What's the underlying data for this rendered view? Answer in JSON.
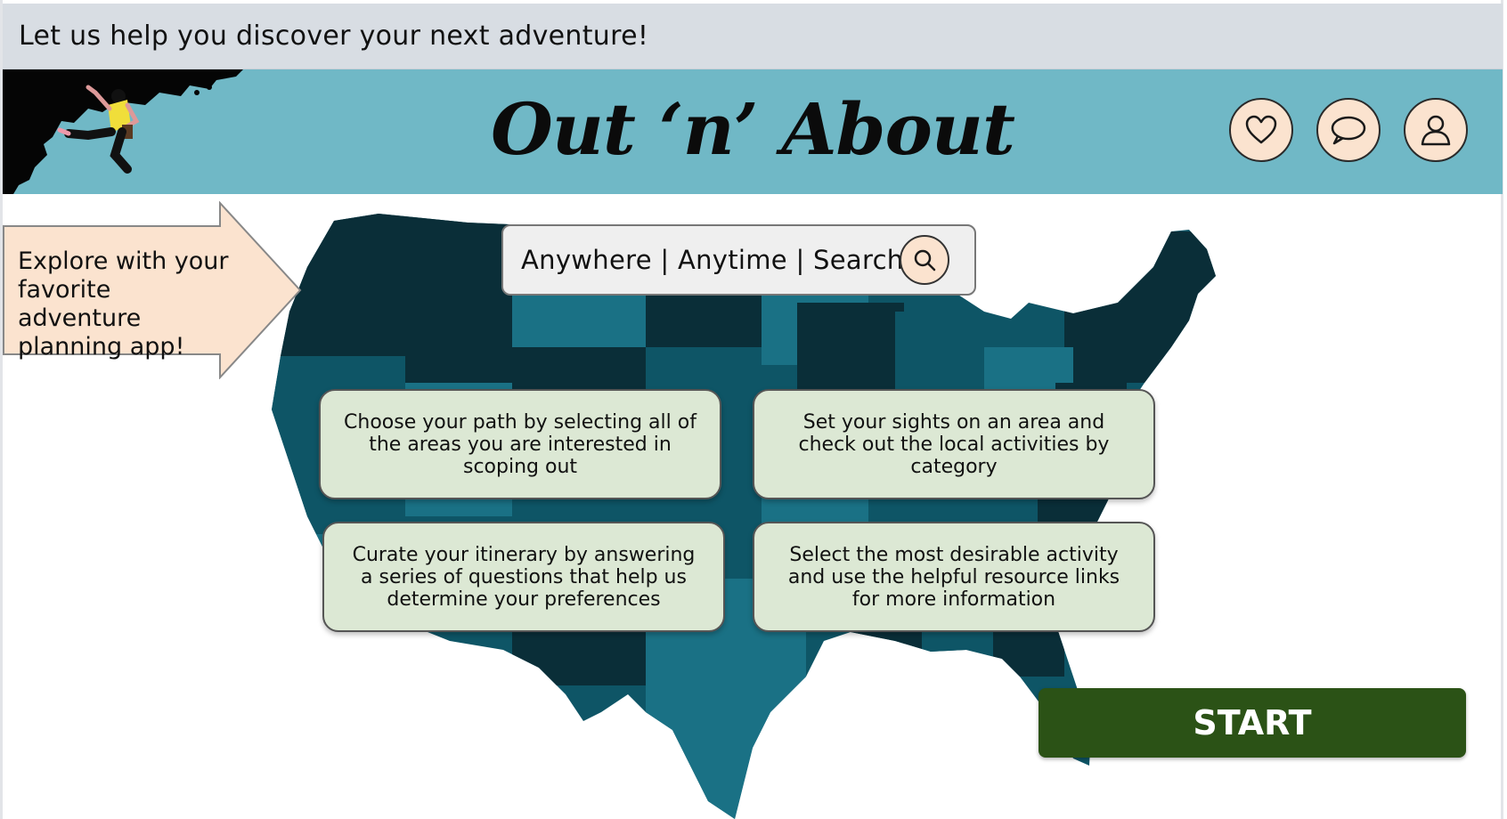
{
  "banner": {
    "text": "Let us help you discover your next adventure!"
  },
  "header": {
    "logo": "Out ‘n’ About",
    "icons": [
      "heart-icon",
      "chat-bubble-icon",
      "user-icon"
    ]
  },
  "callout": {
    "text": "Explore with your favorite adventure planning app!"
  },
  "search": {
    "label": "Anywhere | Anytime | Search",
    "icon": "search-icon"
  },
  "features": [
    {
      "text": "Choose your path by selecting all of the areas you are interested in scoping out"
    },
    {
      "text": "Set your sights on an area and check out the local activities by category"
    },
    {
      "text": "Curate your itinerary by answering a series of questions that help us determine your preferences"
    },
    {
      "text": "Select the most desirable activity and use the helpful resource links for more information"
    }
  ],
  "start": {
    "label": "START"
  },
  "colors": {
    "banner_bg": "#d8dde3",
    "header_bg": "#70b8c6",
    "icon_bg": "#fbe3cf",
    "card_bg": "#dce8d4",
    "start_bg": "#2b5216",
    "map_dark": "#0a2e38",
    "map_mid": "#0e5566",
    "map_light": "#1a7185"
  }
}
